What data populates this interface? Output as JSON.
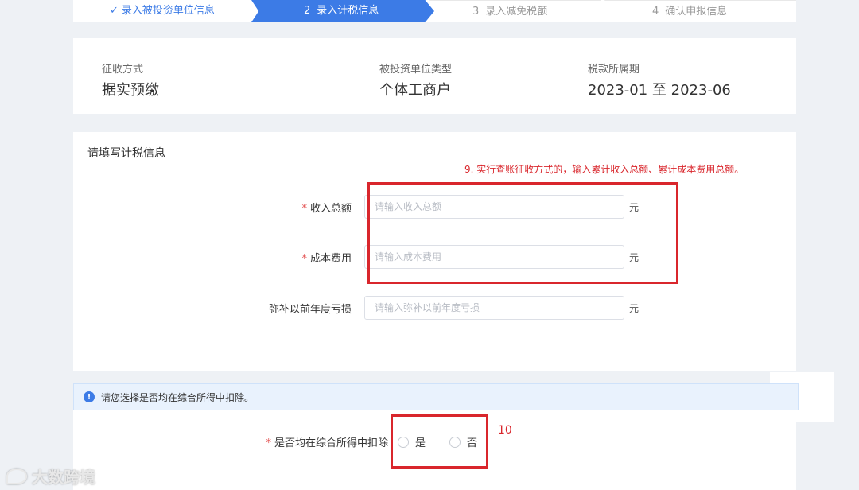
{
  "stepper": {
    "step1": {
      "check": "✓",
      "label": "录入被投资单位信息"
    },
    "step2": {
      "num": "2",
      "label": "录入计税信息"
    },
    "step3": {
      "num": "3",
      "label": "录入减免税额"
    },
    "step4": {
      "num": "4",
      "label": "确认申报信息"
    }
  },
  "info": {
    "collection_method": {
      "label": "征收方式",
      "value": "据实预缴"
    },
    "unit_type": {
      "label": "被投资单位类型",
      "value": "个体工商户"
    },
    "tax_period": {
      "label": "税款所属期",
      "value": "2023-01 至 2023-06"
    }
  },
  "form": {
    "title": "请填写计税信息",
    "required_mark": "*",
    "fields": [
      {
        "label": "收入总额",
        "placeholder": "请输入收入总额",
        "value": "",
        "unit": "元"
      },
      {
        "label": "成本费用",
        "placeholder": "请输入成本费用",
        "value": "",
        "unit": "元"
      },
      {
        "label": "弥补以前年度亏损",
        "placeholder": "请输入弥补以前年度亏损",
        "value": "",
        "unit": "元"
      }
    ]
  },
  "notice": {
    "icon": "!",
    "text": "请您选择是否均在综合所得中扣除。"
  },
  "deduction": {
    "label": "是否均在综合所得中扣除",
    "options": [
      "是",
      "否"
    ]
  },
  "annotations": {
    "note9": "9. 实行查账征收方式的，输入累计收入总额、累计成本费用总额。",
    "note10": "10"
  },
  "watermark": {
    "text": "大数跨境"
  },
  "colors": {
    "accent": "#3c7be6",
    "annotation": "#d9262c",
    "required": "#e24c4c"
  }
}
